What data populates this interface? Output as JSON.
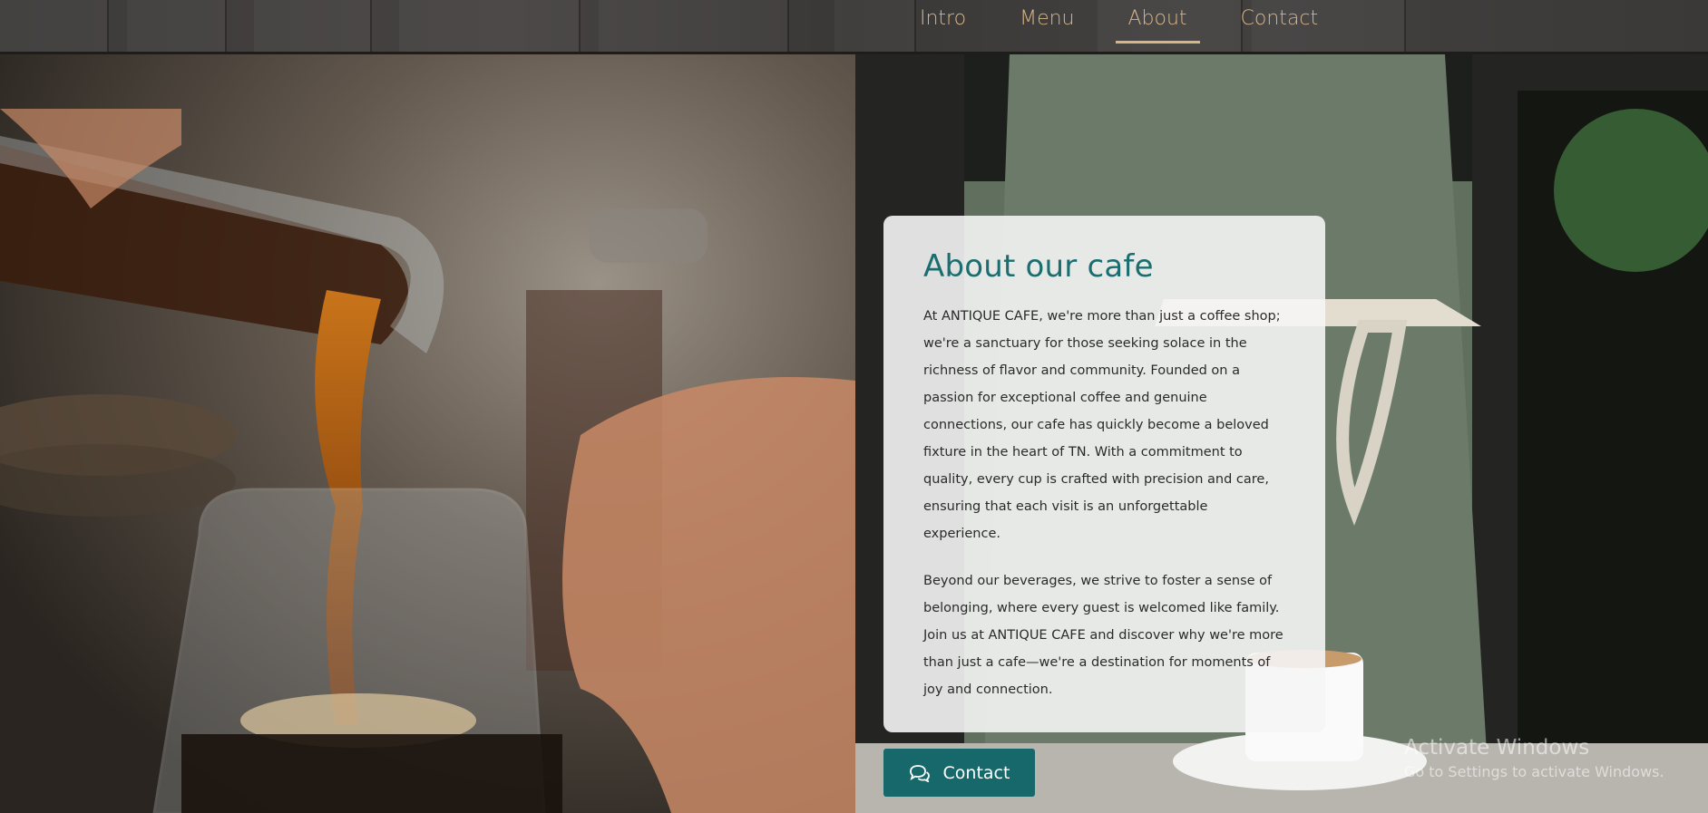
{
  "nav": {
    "items": [
      {
        "label": "Intro"
      },
      {
        "label": "Menu"
      },
      {
        "label": "About"
      },
      {
        "label": "Contact"
      }
    ],
    "active": "About",
    "accent_color": "#d7b587"
  },
  "about": {
    "title": "About our cafe",
    "paragraphs": [
      "At ANTIQUE CAFE, we're more than just a coffee shop; we're a sanctuary for those seeking solace in the richness of flavor and community. Founded on a passion for exceptional coffee and genuine connections, our cafe has quickly become a beloved fixture in the heart of TN. With a commitment to quality, every cup is crafted with precision and care, ensuring that each visit is an unforgettable experience.",
      "Beyond our beverages, we strive to foster a sense of belonging, where every guest is welcomed like family. Join us at ANTIQUE CAFE and discover why we're more than just a cafe—we're a destination for moments of joy and connection."
    ],
    "title_color": "#1b6e70"
  },
  "contact_button": {
    "label": "Contact",
    "icon": "comments-icon",
    "color": "#16686a"
  },
  "images": {
    "left": "coffee-pour-over-photo",
    "right": "barista-serving-coffee-photo"
  },
  "watermark": {
    "title": "Activate Windows",
    "subtitle": "Go to Settings to activate Windows."
  }
}
